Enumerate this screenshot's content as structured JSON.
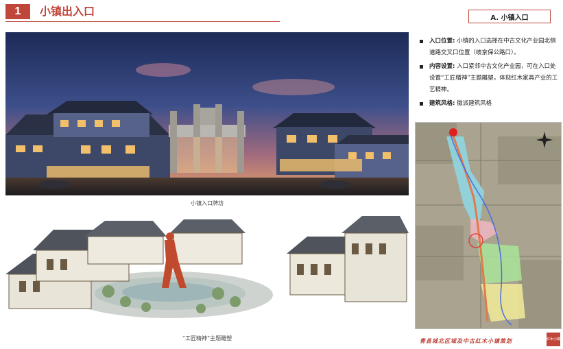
{
  "header": {
    "number": "1",
    "title": "小镇出入口",
    "section_label": "A. 小镇入口"
  },
  "photos": {
    "top_caption": "小镇入口牌坊",
    "bottom_caption": "“工匠精神”主题雕塑"
  },
  "bullets": [
    {
      "label": "入口位置:",
      "text": "小镇的入口选择在中古文化产业园北侧道路交叉口位置（岐京保公路口）。"
    },
    {
      "label": "内容设置:",
      "text": "入口紧邻中古文化产业园，可在入口处设置“工匠精神”主题雕塑，体现红木家具产业的工艺精神。"
    },
    {
      "label": "建筑风格:",
      "text": "徽派建筑风格"
    }
  ],
  "footer": {
    "text": "青县城北区域及中古红木小镇策划",
    "logo": "红木小镇"
  },
  "colors": {
    "accent": "#c0453b"
  }
}
